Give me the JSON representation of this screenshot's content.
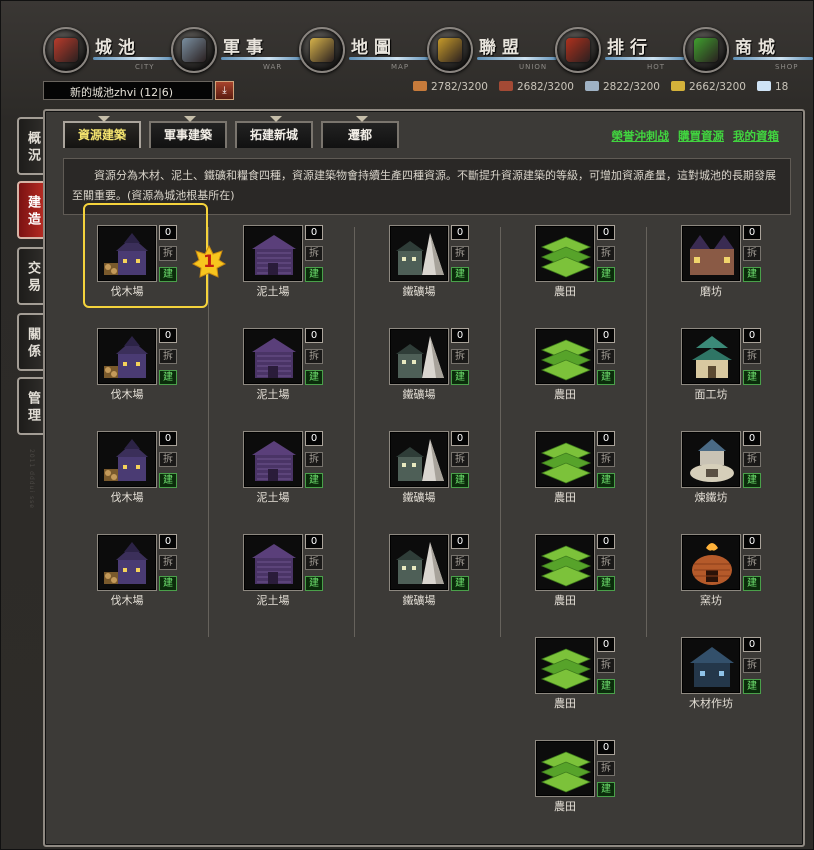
{
  "nav": [
    {
      "name": "nav-city",
      "title": "城池",
      "sub": "CITY",
      "color": "#b93b2b"
    },
    {
      "name": "nav-war",
      "title": "軍事",
      "sub": "WAR",
      "color": "#7a8fa0"
    },
    {
      "name": "nav-map",
      "title": "地圖",
      "sub": "MAP",
      "color": "#d6b24a"
    },
    {
      "name": "nav-union",
      "title": "聯盟",
      "sub": "UNION",
      "color": "#c79b2a"
    },
    {
      "name": "nav-hot",
      "title": "排行",
      "sub": "HOT",
      "color": "#b0311d"
    },
    {
      "name": "nav-shop",
      "title": "商城",
      "sub": "SHOP",
      "color": "#3fa02e"
    }
  ],
  "city": {
    "name": "新的城池zhvi  (12|6)"
  },
  "resources": [
    {
      "icon": "wood-icon",
      "value": "2782/3200",
      "color": "#c77b3b"
    },
    {
      "icon": "clay-icon",
      "value": "2682/3200",
      "color": "#a34a35"
    },
    {
      "icon": "iron-icon",
      "value": "2822/3200",
      "color": "#9fb2c4"
    },
    {
      "icon": "grain-icon",
      "value": "2662/3200",
      "color": "#d4b23a"
    },
    {
      "icon": "gem-icon",
      "value": "18",
      "color": "#cfe3f5"
    }
  ],
  "side_tabs": [
    "概況",
    "建造",
    "交易",
    "關係",
    "管理"
  ],
  "tabs": [
    "資源建築",
    "軍事建築",
    "拓建新城",
    "遷都"
  ],
  "links": [
    "榮誉沖刺战",
    "購買資源",
    "我的資箱"
  ],
  "description": "資源分為木材、泥土、鐵礦和糧食四種，資源建築物會持續生產四種資源。不斷提升資源建築的等級，可增加資源產量，這對城池的長期發展至關重要。(資源為城池根基所在)",
  "building_labels": {
    "level": "0",
    "demolish": "拆",
    "build": "建"
  },
  "callout": "1",
  "watermark": "2011 dddui sse",
  "columns": [
    [
      {
        "name": "伐木場",
        "type": "lumber",
        "level": "0"
      },
      {
        "name": "伐木場",
        "type": "lumber",
        "level": "0"
      },
      {
        "name": "伐木場",
        "type": "lumber",
        "level": "0"
      },
      {
        "name": "伐木場",
        "type": "lumber",
        "level": "0"
      }
    ],
    [
      {
        "name": "泥土場",
        "type": "clay",
        "level": "0"
      },
      {
        "name": "泥土場",
        "type": "clay",
        "level": "0"
      },
      {
        "name": "泥土場",
        "type": "clay",
        "level": "0"
      },
      {
        "name": "泥土場",
        "type": "clay",
        "level": "0"
      }
    ],
    [
      {
        "name": "鐵礦場",
        "type": "iron",
        "level": "0"
      },
      {
        "name": "鐵礦場",
        "type": "iron",
        "level": "0"
      },
      {
        "name": "鐵礦場",
        "type": "iron",
        "level": "0"
      },
      {
        "name": "鐵礦場",
        "type": "iron",
        "level": "0"
      }
    ],
    [
      {
        "name": "農田",
        "type": "farm",
        "level": "0"
      },
      {
        "name": "農田",
        "type": "farm",
        "level": "0"
      },
      {
        "name": "農田",
        "type": "farm",
        "level": "0"
      },
      {
        "name": "農田",
        "type": "farm",
        "level": "0"
      },
      {
        "name": "農田",
        "type": "farm",
        "level": "0"
      },
      {
        "name": "農田",
        "type": "farm",
        "level": "0"
      }
    ],
    [
      {
        "name": "磨坊",
        "type": "mill",
        "level": "0"
      },
      {
        "name": "面工坊",
        "type": "pagoda",
        "level": "0"
      },
      {
        "name": "煉鐵坊",
        "type": "smelter",
        "level": "0"
      },
      {
        "name": "窯坊",
        "type": "kiln",
        "level": "0"
      },
      {
        "name": "木材作坊",
        "type": "sawmill",
        "level": "0"
      }
    ]
  ]
}
